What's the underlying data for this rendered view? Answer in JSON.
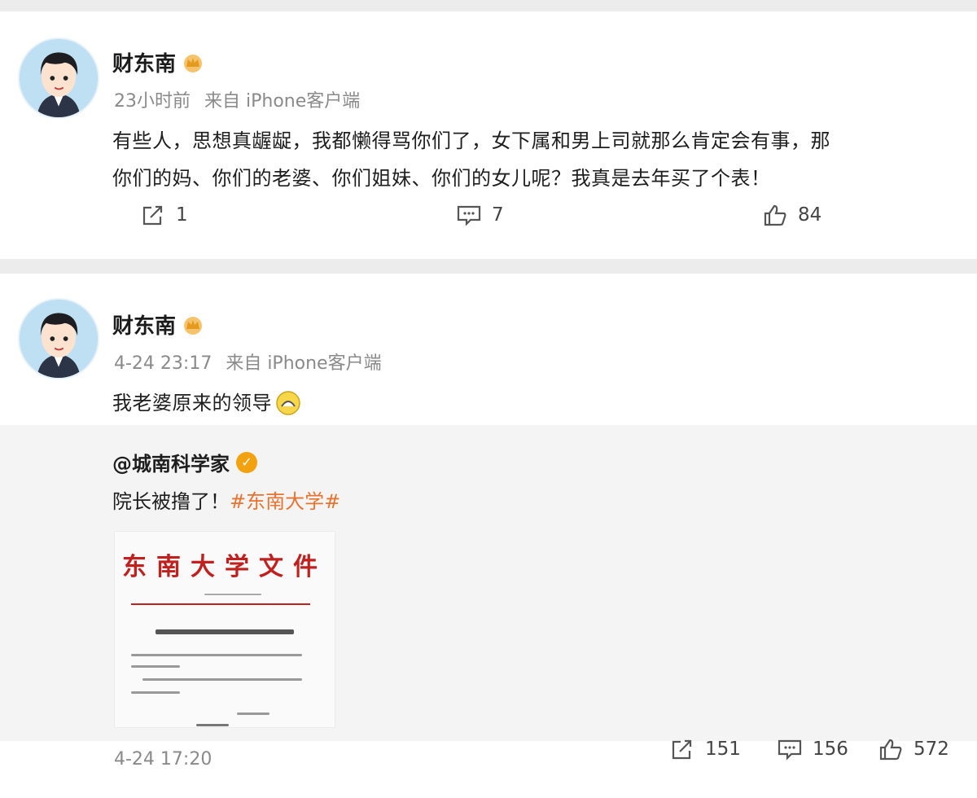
{
  "posts": [
    {
      "author": "财东南",
      "time": "23小时前",
      "source": "来自 iPhone客户端",
      "text_lines": [
        "有些人，思想真龌龊，我都懒得骂你们了，女下属和男上司就那么肯定会有事，那",
        "你们的妈、你们的老婆、你们姐妹、你们的女儿呢？我真是去年买了个表！"
      ],
      "repost_count": "1",
      "comment_count": "7",
      "like_count": "84"
    },
    {
      "author": "财东南",
      "time": "4-24 23:17",
      "source": "来自 iPhone客户端",
      "text": "我老婆原来的领导",
      "emoji": "smile-emoji",
      "retweet": {
        "author": "@城南科学家",
        "text": "院长被撸了！",
        "hashtag": "#东南大学#",
        "document_title": "东南大学文件",
        "time": "4-24 17:20",
        "repost_count": "151",
        "comment_count": "156",
        "like_count": "572"
      }
    }
  ],
  "colors": {
    "page_bg": "#ececec",
    "card_bg": "#ffffff",
    "repost_bg": "#f4f4f4",
    "meta_text": "#8a8a8a",
    "hashtag": "#e8722f",
    "badge": "#f2a20f",
    "doc_red": "#c0201e"
  },
  "icons": [
    "crown-badge-icon",
    "repost-icon",
    "comment-icon",
    "like-icon",
    "verified-badge-icon"
  ]
}
